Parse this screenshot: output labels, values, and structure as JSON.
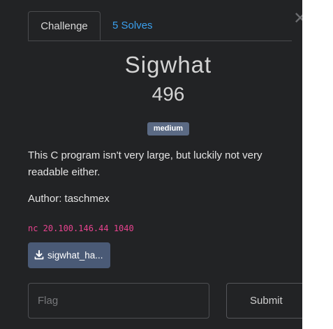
{
  "tabs": {
    "challenge": "Challenge",
    "solves": "5 Solves"
  },
  "challenge": {
    "name": "Sigwhat",
    "points": "496",
    "difficulty": "medium",
    "description": "This C program isn't very large, but luckily not very readable either.",
    "author": "Author: taschmex",
    "connection": "nc 20.100.146.44 1040"
  },
  "file": {
    "label": "sigwhat_ha..."
  },
  "flag": {
    "placeholder": "Flag",
    "value": ""
  },
  "submit": {
    "label": "Submit"
  },
  "colors": {
    "background": "#222325",
    "link": "#3aa0ef",
    "badge": "#5b6a84",
    "code": "#e8438f",
    "file_button": "#4a5a76"
  },
  "icons": {
    "close": "close-icon",
    "download": "download-icon"
  }
}
